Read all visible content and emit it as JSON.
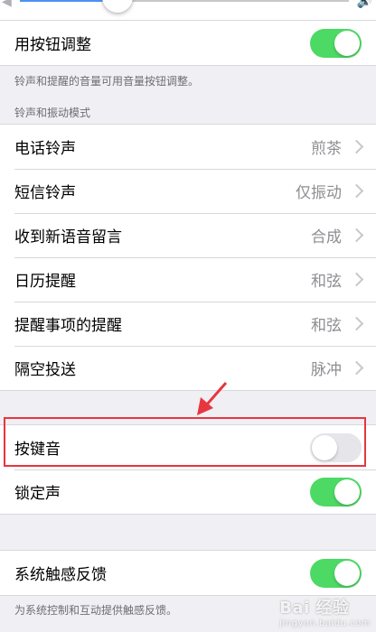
{
  "volume": {
    "level": 0.25,
    "left_icon": "speaker-low-icon",
    "right_icon": "speaker-high-icon"
  },
  "adjust_with_buttons": {
    "label": "用按钮调整",
    "enabled": true,
    "note": "铃声和提醒的音量可用音量按钮调整。"
  },
  "sounds_section": {
    "header": "铃声和振动模式",
    "items": [
      {
        "label": "电话铃声",
        "value": "煎茶"
      },
      {
        "label": "短信铃声",
        "value": "仅振动"
      },
      {
        "label": "收到新语音留言",
        "value": "合成"
      },
      {
        "label": "日历提醒",
        "value": "和弦"
      },
      {
        "label": "提醒事项的提醒",
        "value": "和弦"
      },
      {
        "label": "隔空投送",
        "value": "脉冲"
      }
    ]
  },
  "keyboard_clicks": {
    "label": "按键音",
    "enabled": false
  },
  "lock_sound": {
    "label": "锁定声",
    "enabled": true
  },
  "haptics": {
    "label": "系统触感反馈",
    "enabled": true,
    "note": "为系统控制和互动提供触感反馈。"
  },
  "annotation_color": "#e8363e",
  "switch_on_color": "#4cd964",
  "watermark": {
    "text": "Bai 经验",
    "sub": "jingyan.baidu.com"
  }
}
